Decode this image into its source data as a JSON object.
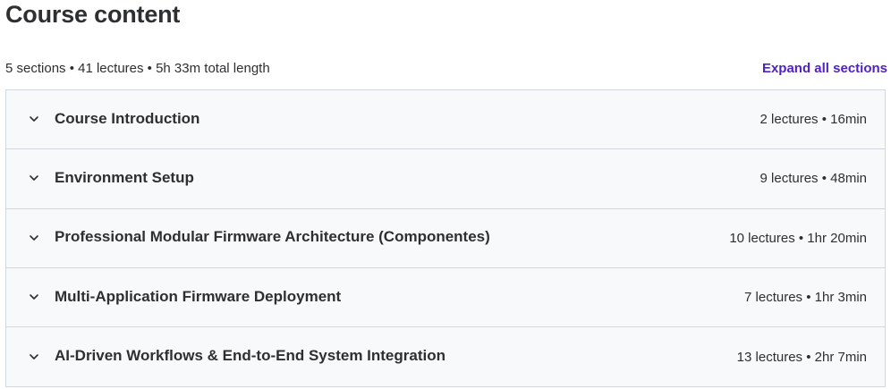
{
  "header": {
    "title": "Course content"
  },
  "summary": {
    "text": "5 sections • 41 lectures • 5h 33m total length",
    "expand_label": "Expand all sections"
  },
  "sections": [
    {
      "title": "Course Introduction",
      "meta": "2 lectures • 16min"
    },
    {
      "title": "Environment Setup",
      "meta": "9 lectures • 48min"
    },
    {
      "title": "Professional Modular Firmware Architecture (Componentes)",
      "meta": "10 lectures • 1hr 20min"
    },
    {
      "title": "Multi-Application Firmware Deployment",
      "meta": "7 lectures • 1hr 3min"
    },
    {
      "title": "AI-Driven Workflows & End-to-End System Integration",
      "meta": "13 lectures • 2hr 7min"
    }
  ],
  "icons": {
    "section_toggle": "chevron-down-icon"
  },
  "colors": {
    "accent": "#5022c3",
    "text": "#2d2f31",
    "row_bg": "#f7f9fa",
    "border": "#d1d7dc"
  }
}
